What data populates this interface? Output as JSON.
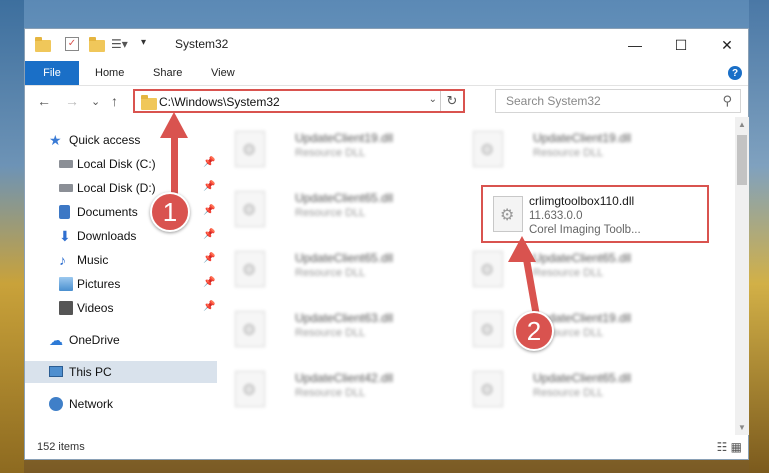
{
  "window": {
    "title": "System32",
    "controls": {
      "minimize": "—",
      "maximize": "☐",
      "close": "✕"
    }
  },
  "ribbon": {
    "tabs": [
      "File",
      "Home",
      "Share",
      "View"
    ],
    "help": "?"
  },
  "nav": {
    "back": "←",
    "forward": "→",
    "recent": "⌄",
    "up": "↑",
    "address": "C:\\Windows\\System32",
    "search_placeholder": "Search System32"
  },
  "sidebar": {
    "items": [
      {
        "label": "Quick access",
        "icon": "star-icon"
      },
      {
        "label": "Local Disk (C:)",
        "icon": "disk-icon",
        "pinned": true
      },
      {
        "label": "Local Disk (D:)",
        "icon": "disk-icon",
        "pinned": true
      },
      {
        "label": "Documents",
        "icon": "documents-icon",
        "pinned": true
      },
      {
        "label": "Downloads",
        "icon": "downloads-icon",
        "pinned": true
      },
      {
        "label": "Music",
        "icon": "music-icon",
        "pinned": true
      },
      {
        "label": "Pictures",
        "icon": "pictures-icon",
        "pinned": true
      },
      {
        "label": "Videos",
        "icon": "videos-icon",
        "pinned": true
      },
      {
        "label": "OneDrive",
        "icon": "cloud-icon"
      },
      {
        "label": "This PC",
        "icon": "pc-icon",
        "selected": true
      },
      {
        "label": "Network",
        "icon": "network-icon"
      }
    ]
  },
  "files": [
    {
      "name": "UpdateClient19.dll",
      "desc": "Resource DLL"
    },
    {
      "name": "UpdateClient19.dll",
      "desc": "Resource DLL"
    },
    {
      "name": "UpdateClient65.dll",
      "desc": "Resource DLL"
    },
    {
      "name": "UpdateClient65.dll",
      "desc": "Resource DLL"
    },
    {
      "name": "UpdateClient65.dll",
      "desc": "Resource DLL"
    },
    {
      "name": "UpdateClient63.dll",
      "desc": "Resource DLL"
    },
    {
      "name": "UpdateClient19.dll",
      "desc": "Resource DLL"
    },
    {
      "name": "UpdateClient42.dll",
      "desc": "Resource DLL"
    },
    {
      "name": "UpdateClient65.dll",
      "desc": "Resource DLL"
    }
  ],
  "highlighted_file": {
    "name": "crlimgtoolbox110.dll",
    "version": "11.633.0.0",
    "desc": "Corel Imaging Toolb..."
  },
  "status": {
    "count": "152 items"
  },
  "annotations": {
    "step1": "1",
    "step2": "2",
    "color": "#d9534f"
  }
}
